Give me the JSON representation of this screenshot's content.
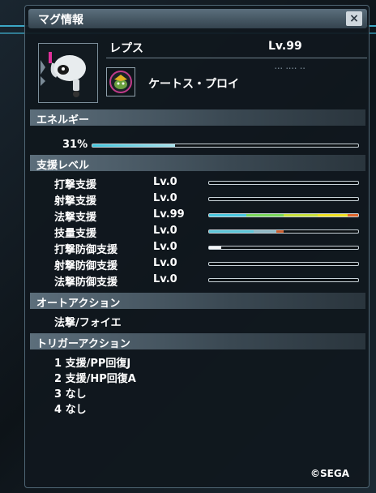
{
  "window": {
    "title": "マグ情報",
    "close_label": "×"
  },
  "mag": {
    "name": "レプス",
    "level": "Lv.99",
    "subtext": "ꞏꞏꞏ ꞏꞏꞏꞏ ꞏꞏ",
    "photon_blast": "ケートス・プロイ"
  },
  "energy": {
    "header": "エネルギー",
    "percent_label": "31%",
    "fraction": 0.31
  },
  "support": {
    "header": "支援レベル",
    "rows": [
      {
        "label": "打撃支援",
        "level": "Lv.0",
        "segments": []
      },
      {
        "label": "射撃支援",
        "level": "Lv.0",
        "segments": []
      },
      {
        "label": "法撃支援",
        "level": "Lv.99",
        "segments": [
          {
            "start": 0,
            "end": 0.25,
            "color": "#49c8e0"
          },
          {
            "start": 0.25,
            "end": 0.5,
            "color": "#7ad85a"
          },
          {
            "start": 0.5,
            "end": 0.73,
            "color": "#c8e03a"
          },
          {
            "start": 0.73,
            "end": 0.93,
            "color": "#f0e020"
          },
          {
            "start": 0.93,
            "end": 1.0,
            "color": "#e0662a"
          }
        ]
      },
      {
        "label": "技量支援",
        "level": "Lv.0",
        "segments": [
          {
            "start": 0,
            "end": 0.3,
            "color": "#5cc6d8"
          },
          {
            "start": 0.3,
            "end": 0.45,
            "color": "#8fb8c4"
          },
          {
            "start": 0.45,
            "end": 0.5,
            "color": "#c85a2a"
          }
        ]
      },
      {
        "label": "打撃防御支援",
        "level": "Lv.0",
        "segments": [
          {
            "start": 0,
            "end": 0.08,
            "color": "#f4f6f8"
          }
        ]
      },
      {
        "label": "射撃防御支援",
        "level": "Lv.0",
        "segments": []
      },
      {
        "label": "法撃防御支援",
        "level": "Lv.0",
        "segments": []
      }
    ]
  },
  "auto_action": {
    "header": "オートアクション",
    "value": "法撃/フォイエ"
  },
  "trigger_action": {
    "header": "トリガーアクション",
    "items": [
      {
        "number": "1",
        "text": "支援/PP回復J"
      },
      {
        "number": "2",
        "text": "支援/HP回復A"
      },
      {
        "number": "3",
        "text": "なし"
      },
      {
        "number": "4",
        "text": "なし"
      }
    ]
  },
  "copyright": "©SEGA"
}
